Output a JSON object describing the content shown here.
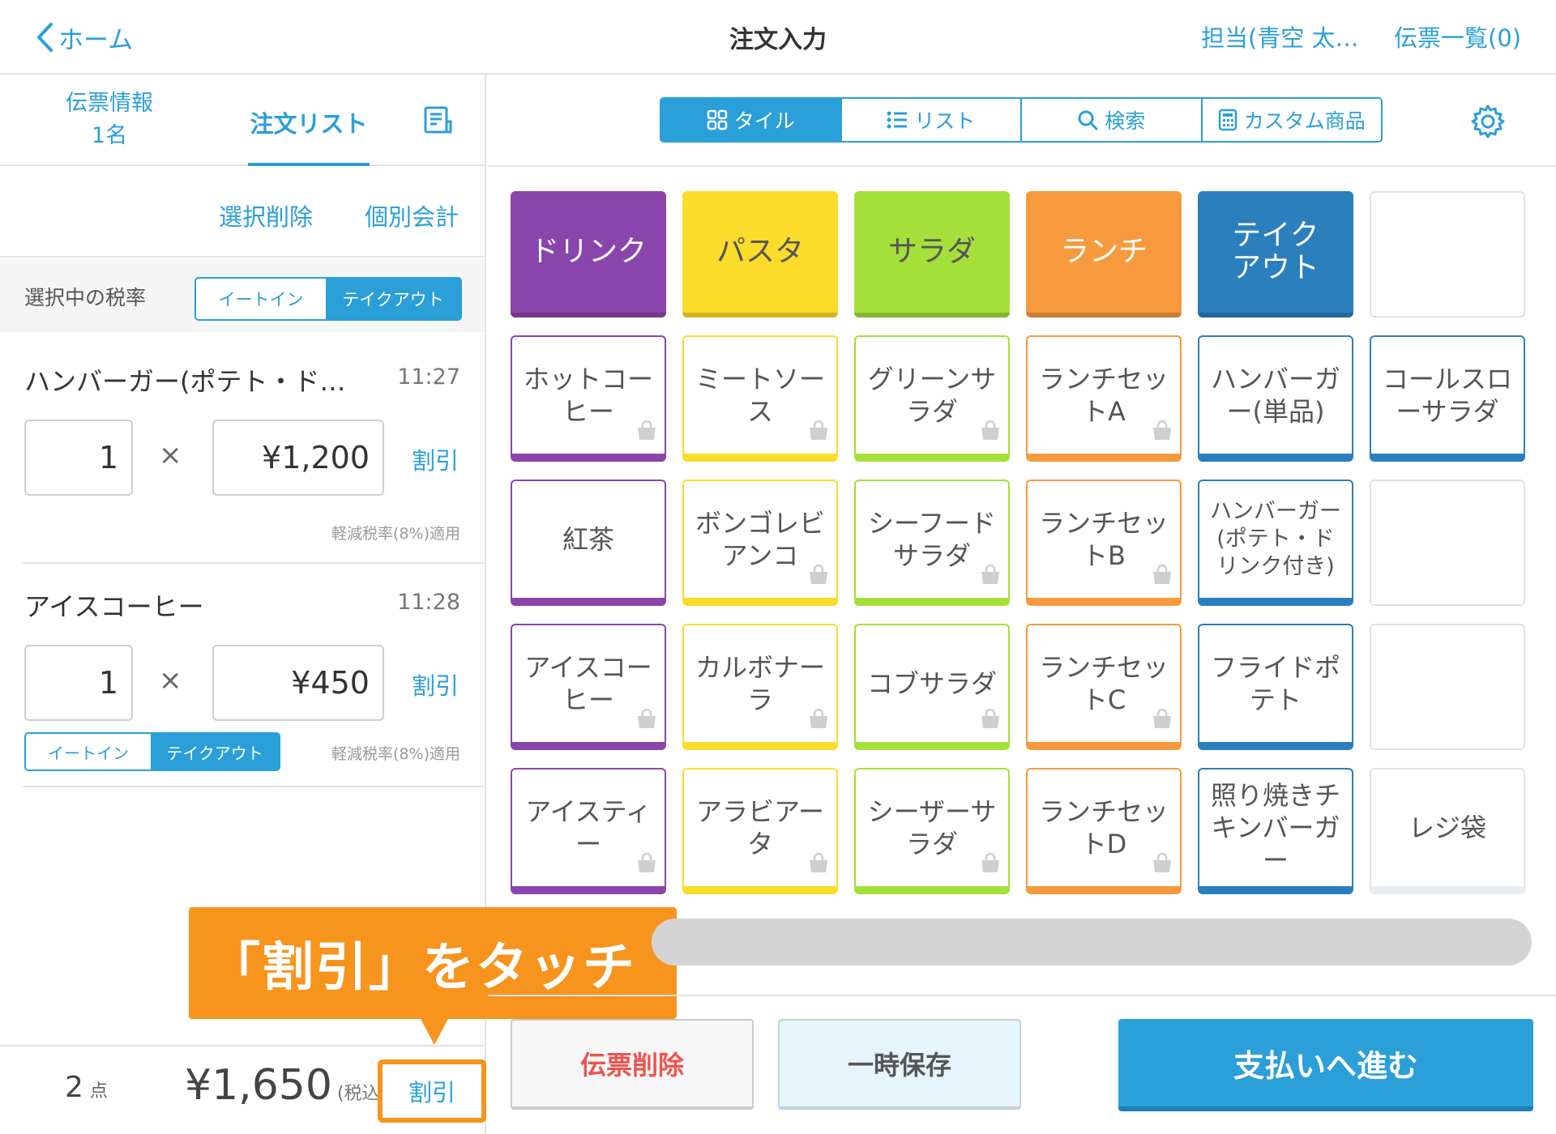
{
  "header": {
    "back_label": "ホーム",
    "title": "注文入力",
    "staff": "担当(青空 太…",
    "slips": "伝票一覧(0)"
  },
  "left_tabs": {
    "info_line1": "伝票情報",
    "info_line2": "1名",
    "order_list": "注文リスト"
  },
  "actions": {
    "delete_selected": "選択削除",
    "split_payment": "個別会計"
  },
  "tax": {
    "label": "選択中の税率",
    "eat_in": "イートイン",
    "take_out": "テイクアウト",
    "selected": "テイクアウト"
  },
  "order_items": [
    {
      "name": "ハンバーガー(ポテト・ド…",
      "time": "11:27",
      "qty": "1",
      "times": "×",
      "price": "¥1,200",
      "discount": "割引",
      "note": "軽減税率(8%)適用"
    },
    {
      "name": "アイスコーヒー",
      "time": "11:28",
      "qty": "1",
      "times": "×",
      "price": "¥450",
      "discount": "割引",
      "note": "軽減税率(8%)適用",
      "eat_in": "イートイン",
      "take_out": "テイクアウト"
    }
  ],
  "footer": {
    "count": "2",
    "count_unit": "点",
    "total": "¥1,650",
    "tax_note": "(税込)",
    "discount": "割引"
  },
  "callout": "「割引」をタッチ",
  "view_tabs": [
    "タイル",
    "リスト",
    "検索",
    "カスタム商品"
  ],
  "categories": [
    {
      "label": "ドリンク",
      "color": "#8a45ad"
    },
    {
      "label": "パスタ",
      "color": "#fcdc2a"
    },
    {
      "label": "サラダ",
      "color": "#a5e03a"
    },
    {
      "label": "ランチ",
      "color": "#f79a3e"
    },
    {
      "label": "テイクアウト",
      "color": "#2b7fbd"
    }
  ],
  "products": [
    [
      "ホットコーヒー",
      "ミートソース",
      "グリーンサラダ",
      "ランチセットA",
      "ハンバーガー(単品)",
      "コールスローサラダ"
    ],
    [
      "紅茶",
      "ボンゴレビアンコ",
      "シーフードサラダ",
      "ランチセットB",
      "ハンバーガー(ポテト・ドリンク付き)",
      ""
    ],
    [
      "アイスコーヒー",
      "カルボナーラ",
      "コブサラダ",
      "ランチセットC",
      "フライドポテト",
      ""
    ],
    [
      "アイスティー",
      "アラビアータ",
      "シーザーサラダ",
      "ランチセットD",
      "照り焼きチキンバーガー",
      "レジ袋"
    ]
  ],
  "bottom_buttons": {
    "delete_slip": "伝票削除",
    "hold": "一時保存",
    "pay": "支払いへ進む"
  },
  "colors": {
    "accent": "#2a9fd8",
    "callout": "#f7941d",
    "danger": "#ef5350"
  }
}
